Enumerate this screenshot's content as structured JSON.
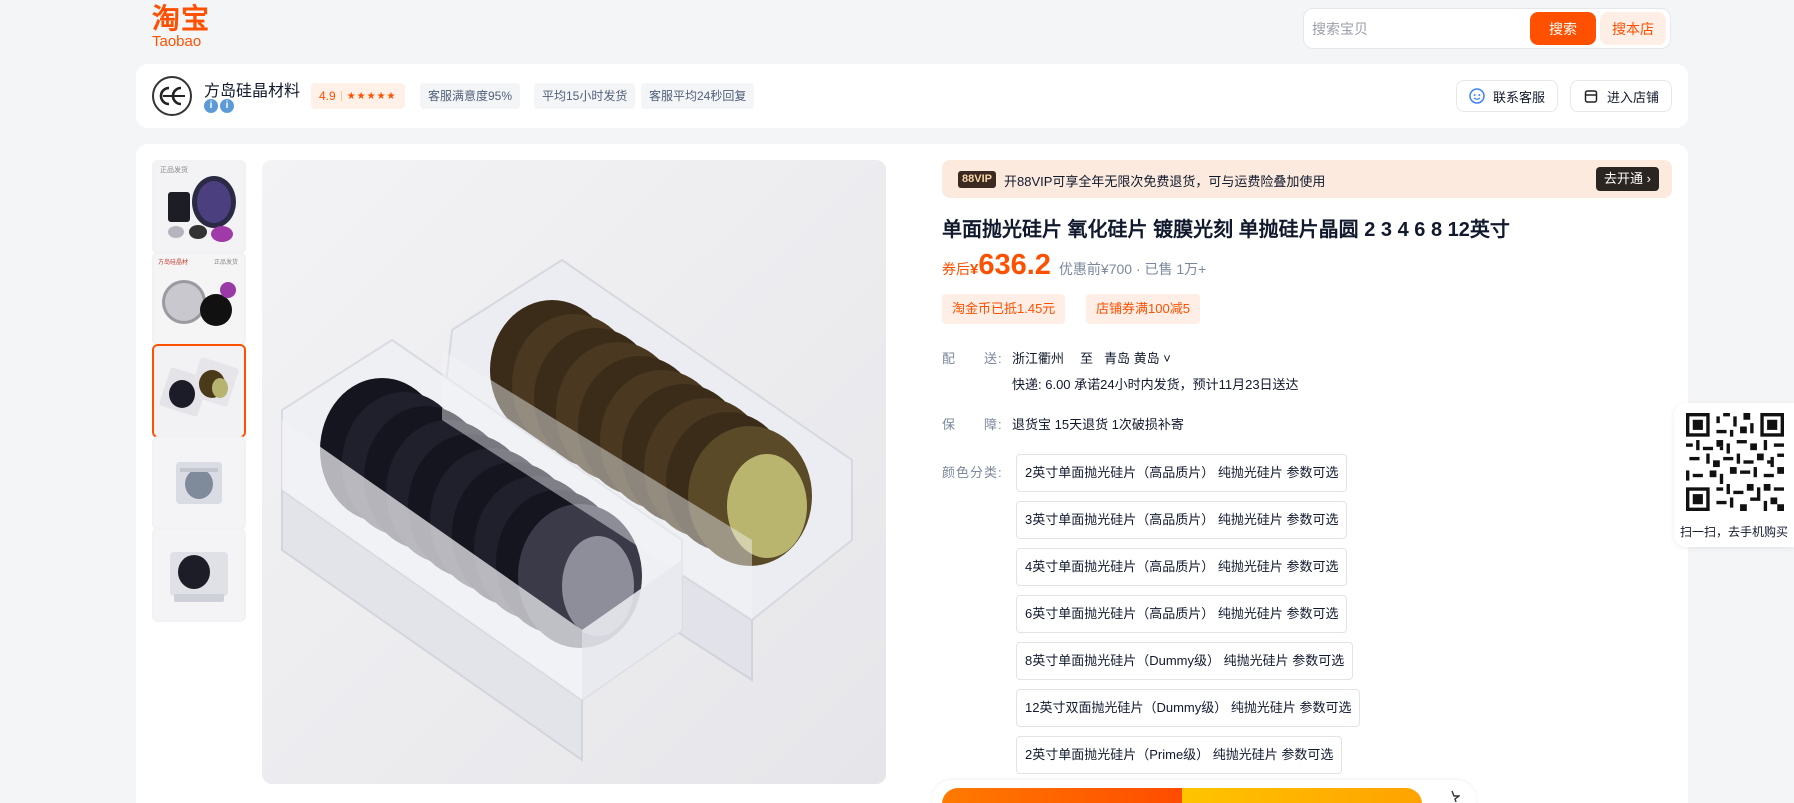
{
  "header": {
    "logo_cn": "淘宝",
    "logo_en": "Taobao",
    "search_placeholder": "搜索宝贝",
    "search_button": "搜索",
    "search_shop_button": "搜本店"
  },
  "shop": {
    "name": "方岛硅晶材料",
    "avatar_text": "FD",
    "rating": "4.9",
    "stars": "★★★★★",
    "tags": [
      "客服满意度95%",
      "平均15小时发货",
      "客服平均24秒回复"
    ],
    "contact_label": "联系客服",
    "enter_label": "进入店铺"
  },
  "vip": {
    "logo": "88VIP",
    "text": "开88VIP可享全年无限次免费退货，可与运费险叠加使用",
    "open_label": "去开通 ›"
  },
  "product": {
    "title": "单面抛光硅片 氧化硅片 镀膜光刻 单抛硅片晶圆 2 3 4 6 8 12英寸",
    "price_prefix": "券后",
    "price_yen": "¥",
    "price": "636.2",
    "price_extra": "优惠前¥700 · 已售 1万+",
    "coupons": [
      "淘金币已抵1.45元",
      "店铺券满100减5"
    ],
    "delivery_label": "配　　送:",
    "delivery_from": "浙江衢州",
    "delivery_to_word": "至",
    "delivery_to": "青岛 黄岛 ˅",
    "delivery_detail": "快递: 6.00  承诺24小时内发货，预计11月23日送达",
    "guarantee_label": "保　　障:",
    "guarantee_detail": "退货宝 15天退货 1次破损补寄",
    "sku_label": "颜色分类:",
    "skus": [
      "2英寸单面抛光硅片（高品质片） 纯抛光硅片 参数可选",
      "3英寸单面抛光硅片（高品质片） 纯抛光硅片 参数可选",
      "4英寸单面抛光硅片（高品质片） 纯抛光硅片 参数可选",
      "6英寸单面抛光硅片（高品质片） 纯抛光硅片 参数可选",
      "8英寸单面抛光硅片（Dummy级） 纯抛光硅片 参数可选",
      "12英寸双面抛光硅片（Dummy级） 纯抛光硅片 参数可选",
      "2英寸单面抛光硅片（Prime级） 纯抛光硅片 参数可选"
    ]
  },
  "gallery": {
    "thumb1_tag": "正品发货",
    "thumb2_tag_left": "方岛硅晶材",
    "thumb2_tag_right": "正品发货"
  },
  "qr": {
    "text": "扫一扫，去手机购买"
  },
  "colors": {
    "accent": "#ff5000",
    "vip_bg": "#fbeadd"
  }
}
